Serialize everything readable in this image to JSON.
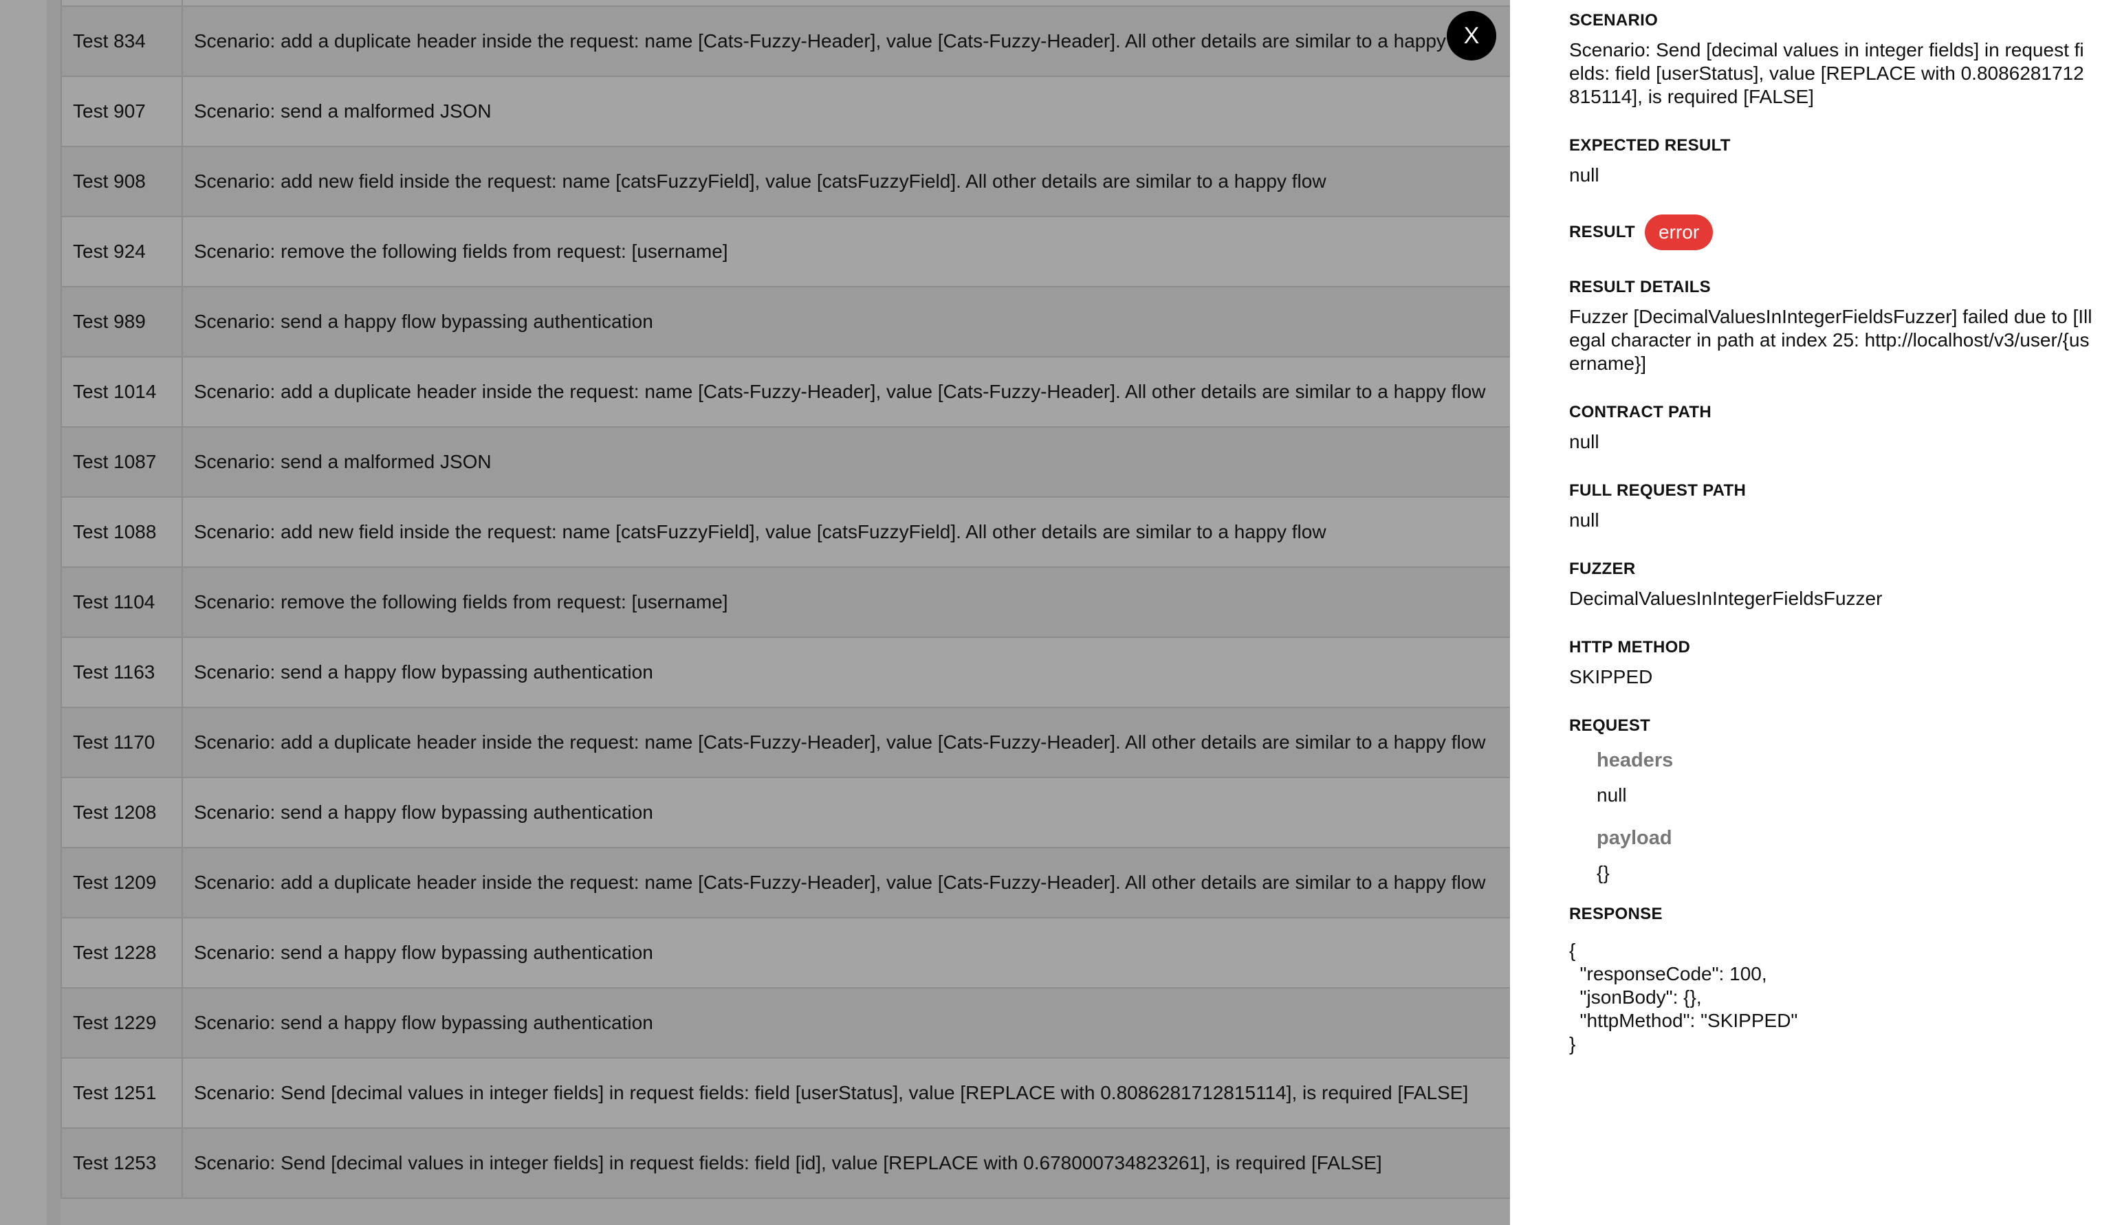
{
  "close_button_label": "X",
  "rows": [
    {
      "id": "Test 834",
      "scenario": "Scenario: add a duplicate header inside the request: name [Cats-Fuzzy-Header], value [Cats-Fuzzy-Header]. All other details are similar to a happy flow"
    },
    {
      "id": "Test 907",
      "scenario": "Scenario: send a malformed JSON"
    },
    {
      "id": "Test 908",
      "scenario": "Scenario: add new field inside the request: name [catsFuzzyField], value [catsFuzzyField]. All other details are similar to a happy flow"
    },
    {
      "id": "Test 924",
      "scenario": "Scenario: remove the following fields from request: [username]"
    },
    {
      "id": "Test 989",
      "scenario": "Scenario: send a happy flow bypassing authentication"
    },
    {
      "id": "Test 1014",
      "scenario": "Scenario: add a duplicate header inside the request: name [Cats-Fuzzy-Header], value [Cats-Fuzzy-Header]. All other details are similar to a happy flow"
    },
    {
      "id": "Test 1087",
      "scenario": "Scenario: send a malformed JSON"
    },
    {
      "id": "Test 1088",
      "scenario": "Scenario: add new field inside the request: name [catsFuzzyField], value [catsFuzzyField]. All other details are similar to a happy flow"
    },
    {
      "id": "Test 1104",
      "scenario": "Scenario: remove the following fields from request: [username]"
    },
    {
      "id": "Test 1163",
      "scenario": "Scenario: send a happy flow bypassing authentication"
    },
    {
      "id": "Test 1170",
      "scenario": "Scenario: add a duplicate header inside the request: name [Cats-Fuzzy-Header], value [Cats-Fuzzy-Header]. All other details are similar to a happy flow"
    },
    {
      "id": "Test 1208",
      "scenario": "Scenario: send a happy flow bypassing authentication"
    },
    {
      "id": "Test 1209",
      "scenario": "Scenario: add a duplicate header inside the request: name [Cats-Fuzzy-Header], value [Cats-Fuzzy-Header]. All other details are similar to a happy flow"
    },
    {
      "id": "Test 1228",
      "scenario": "Scenario: send a happy flow bypassing authentication"
    },
    {
      "id": "Test 1229",
      "scenario": "Scenario: send a happy flow bypassing authentication"
    },
    {
      "id": "Test 1251",
      "scenario": "Scenario: Send [decimal values in integer fields] in request fields: field [userStatus], value [REPLACE with 0.8086281712815114], is required [FALSE]"
    },
    {
      "id": "Test 1253",
      "scenario": "Scenario: Send [decimal values in integer fields] in request fields: field [id], value [REPLACE with 0.678000734823261], is required [FALSE]"
    }
  ],
  "details": {
    "scenario_label": "SCENARIO",
    "scenario_value": "Scenario: Send [decimal values in integer fields] in request fields: field [userStatus], value [REPLACE with 0.8086281712815114], is required [FALSE]",
    "expected_label": "EXPECTED RESULT",
    "expected_value": "null",
    "result_label": "RESULT",
    "result_badge": "error",
    "result_badge_color": "#e53935",
    "result_details_label": "RESULT DETAILS",
    "result_details_value": "Fuzzer [DecimalValuesInIntegerFieldsFuzzer] failed due to [Illegal character in path at index 25: http://localhost/v3/user/{username}]",
    "contract_path_label": "CONTRACT PATH",
    "contract_path_value": "null",
    "full_request_path_label": "FULL REQUEST PATH",
    "full_request_path_value": "null",
    "fuzzer_label": "FUZZER",
    "fuzzer_value": "DecimalValuesInIntegerFieldsFuzzer",
    "http_method_label": "HTTP METHOD",
    "http_method_value": "SKIPPED",
    "request_label": "REQUEST",
    "request_headers_label": "headers",
    "request_headers_value": "null",
    "request_payload_label": "payload",
    "request_payload_value": "{}",
    "response_label": "RESPONSE",
    "response_value": "{\n  \"responseCode\": 100,\n  \"jsonBody\": {},\n  \"httpMethod\": \"SKIPPED\"\n}"
  }
}
